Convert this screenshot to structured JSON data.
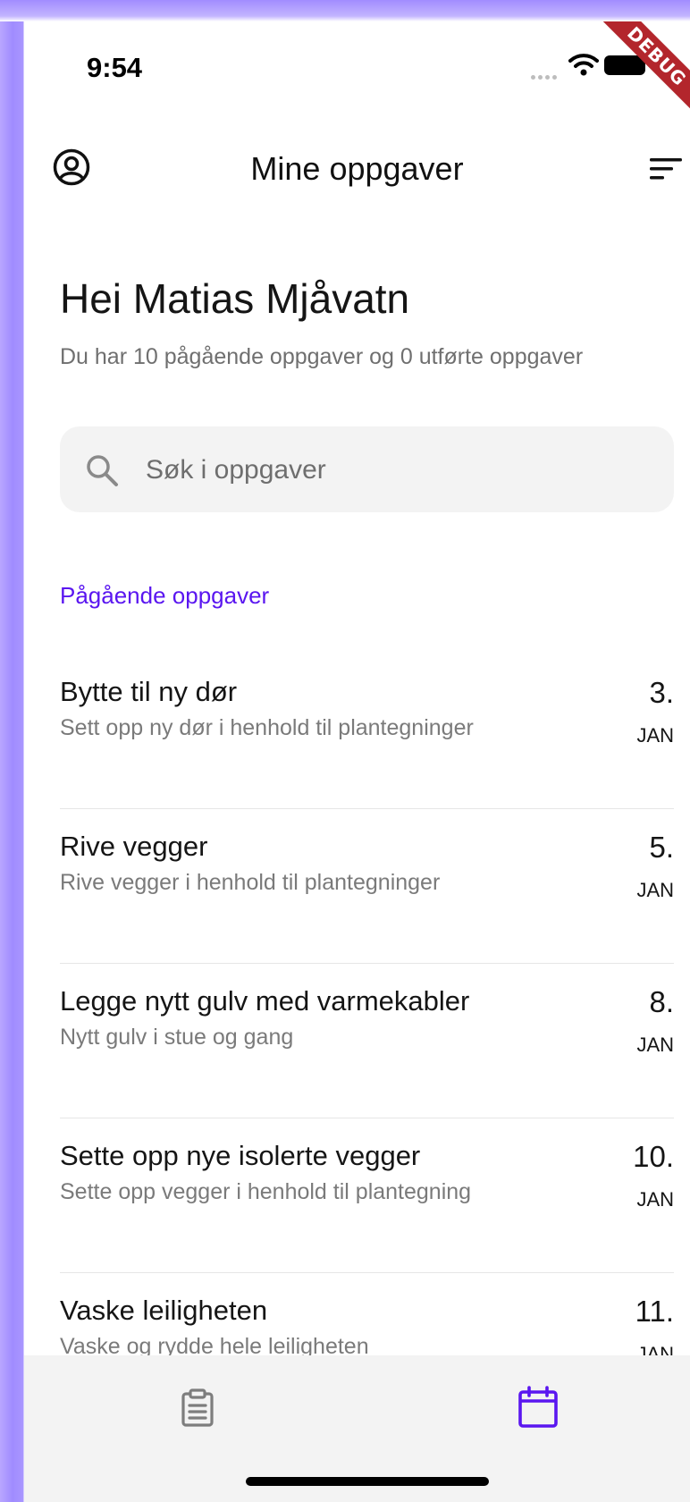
{
  "status_bar": {
    "time": "9:54",
    "debug_label": "DEBUG"
  },
  "app_bar": {
    "title": "Mine oppgaver"
  },
  "greeting": "Hei Matias Mjåvatn",
  "summary": "Du har 10 pågående oppgaver og 0 utførte oppgaver",
  "search": {
    "placeholder": "Søk i oppgaver",
    "value": ""
  },
  "section_title": "Pågående oppgaver",
  "tasks": [
    {
      "title": "Bytte til ny dør",
      "description": "Sett opp ny dør i henhold til plantegninger",
      "day": "3.",
      "month": "JAN"
    },
    {
      "title": "Rive vegger",
      "description": "Rive vegger i henhold til plantegninger",
      "day": "5.",
      "month": "JAN"
    },
    {
      "title": "Legge nytt gulv med varmekabler",
      "description": "Nytt gulv i stue og gang",
      "day": "8.",
      "month": "JAN"
    },
    {
      "title": "Sette opp nye isolerte vegger",
      "description": "Sette opp vegger i henhold til plantegning",
      "day": "10.",
      "month": "JAN"
    },
    {
      "title": "Vaske leiligheten",
      "description": "Vaske og rydde hele leiligheten",
      "day": "11.",
      "month": "JAN"
    }
  ],
  "bottom_nav": {
    "items": [
      {
        "icon": "clipboard-icon",
        "active": false
      },
      {
        "icon": "calendar-icon",
        "active": true
      }
    ]
  },
  "colors": {
    "accent": "#5a16f0",
    "frame": "#a08cff",
    "nav_background": "#f3f3f3",
    "debug_ribbon": "#b3262c"
  }
}
